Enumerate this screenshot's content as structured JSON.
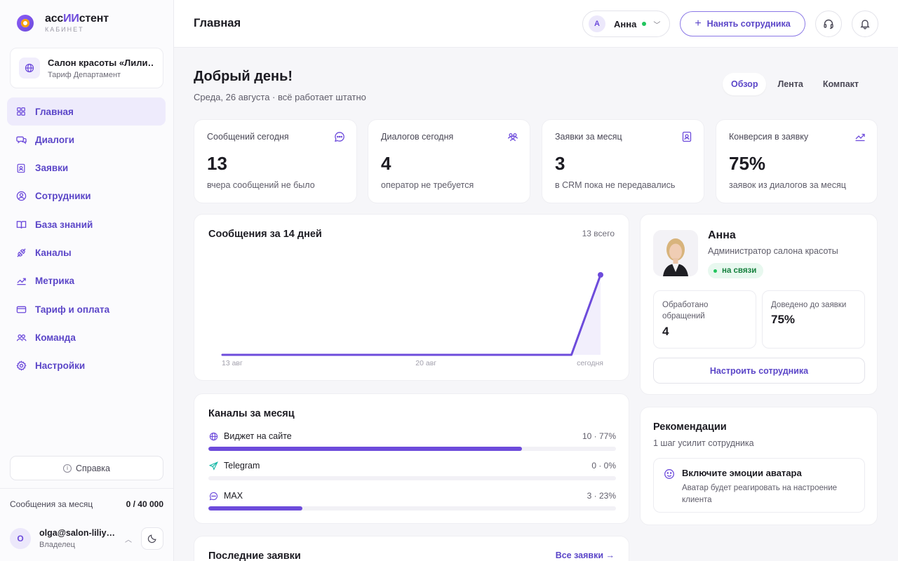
{
  "app": {
    "title_main": "асс",
    "title_accent": "ИИ",
    "title_rest": "стент",
    "subtitle": "КАБИНЕТ"
  },
  "org": {
    "name": "Салон красоты «Лилия»",
    "tariff": "Тариф Департамент",
    "icon": "globe-icon"
  },
  "nav": [
    {
      "label": "Главная",
      "icon": "grid-icon",
      "active": true
    },
    {
      "label": "Диалоги",
      "icon": "chat-icon"
    },
    {
      "label": "Заявки",
      "icon": "lead-icon"
    },
    {
      "label": "Сотрудники",
      "icon": "user-circle-icon"
    },
    {
      "label": "База знаний",
      "icon": "book-icon"
    },
    {
      "label": "Каналы",
      "icon": "plug-icon"
    },
    {
      "label": "Метрика",
      "icon": "trend-icon"
    },
    {
      "label": "Тариф и оплата",
      "icon": "card-icon"
    },
    {
      "label": "Команда",
      "icon": "team-icon"
    },
    {
      "label": "Настройки",
      "icon": "gear-icon"
    }
  ],
  "sidebar_footer": {
    "help_label": "Справка",
    "quota_label": "Сообщения за месяц",
    "quota_value": "0 / 40 000",
    "user_initial": "O",
    "user_email": "olga@salon-liliya.ru",
    "user_role": "Владелец"
  },
  "header": {
    "title": "Главная",
    "profile_initial": "А",
    "profile_name": "Анна",
    "hire_label": "Нанять сотрудника"
  },
  "greeting": {
    "title": "Добрый день!",
    "subtitle": "Среда, 26 августа · всё работает штатно"
  },
  "view_tabs": [
    {
      "label": "Обзор",
      "active": true
    },
    {
      "label": "Лента"
    },
    {
      "label": "Компакт"
    }
  ],
  "stats": [
    {
      "label": "Сообщений сегодня",
      "value": "13",
      "note": "вчера сообщений не было",
      "icon": "message-circle-icon"
    },
    {
      "label": "Диалогов сегодня",
      "value": "4",
      "note": "оператор не требуется",
      "icon": "users-icon"
    },
    {
      "label": "Заявки за месяц",
      "value": "3",
      "note": "в CRM пока не передавались",
      "icon": "lead-icon"
    },
    {
      "label": "Конверсия в заявку",
      "value": "75%",
      "note": "заявок из диалогов за месяц",
      "icon": "trend-icon"
    }
  ],
  "messages_chart": {
    "title": "Сообщения за 14 дней",
    "total_label": "13 всего",
    "chart_data": {
      "type": "line",
      "x": [
        "13 авг",
        "14 авг",
        "15 авг",
        "16 авг",
        "17 авг",
        "18 авг",
        "19 авг",
        "20 авг",
        "21 авг",
        "22 авг",
        "23 авг",
        "24 авг",
        "25 авг",
        "сегодня"
      ],
      "values": [
        0,
        0,
        0,
        0,
        0,
        0,
        0,
        0,
        0,
        0,
        0,
        0,
        0,
        13
      ],
      "x_tick_labels": [
        "13 авг",
        "20 авг",
        "сегодня"
      ],
      "ylim": [
        0,
        13
      ],
      "color": "#6d4bdb"
    }
  },
  "channels": {
    "title": "Каналы за месяц",
    "items": [
      {
        "name": "Виджет на сайте",
        "value": "10 · 77%",
        "percent": 77,
        "icon": "globe-icon"
      },
      {
        "name": "Telegram",
        "value": "0 · 0%",
        "percent": 0,
        "icon": "send-icon"
      },
      {
        "name": "MAX",
        "value": "3 · 23%",
        "percent": 23,
        "icon": "message-circle-icon"
      }
    ]
  },
  "employee": {
    "name": "Анна",
    "role": "Администратор салона красоты",
    "status": "на связи",
    "stats": [
      {
        "label": "Обработано обращений",
        "value": "4"
      },
      {
        "label": "Доведено до заявки",
        "value": "75%"
      }
    ],
    "setup_label": "Настроить сотрудника"
  },
  "recommendations": {
    "title": "Рекомендации",
    "subtitle": "1 шаг усилит сотрудника",
    "item_title": "Включите эмоции аватара",
    "item_text": "Аватар будет реагировать на настроение клиента"
  },
  "leads": {
    "title": "Последние заявки",
    "link": "Все заявки →"
  }
}
